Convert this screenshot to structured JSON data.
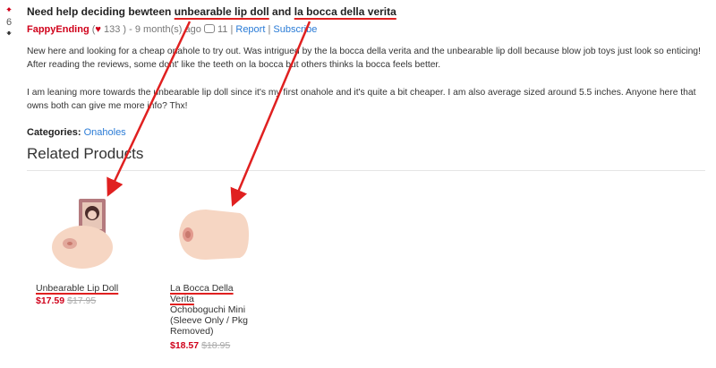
{
  "post": {
    "votes": "6",
    "title_prefix": "Need help deciding bewteen ",
    "title_product_a": "unbearable lip doll",
    "title_and": " and ",
    "title_product_b": "la bocca della verita",
    "author": "FappyEnding",
    "karma": "133",
    "age": ") - 9 month(s) ago",
    "comments": "11",
    "report": "Report",
    "subscribe": "Subscribe",
    "paragraph1": "New here and looking for a cheap onahole to try out. Was intrigued by the la bocca della verita and the unbearable lip doll because blow job toys just look so enticing! After reading the reviews, some dont' like the teeth on la bocca but others thinks la bocca feels better.",
    "paragraph2": "I am leaning more towards the unbearable lip doll since it's my first onahole and it's quite a bit cheaper. I am also average sized around 5.5 inches. Anyone here that owns both can give me more info? Thx!",
    "categories_label": "Categories:",
    "category": "Onaholes"
  },
  "related": {
    "heading": "Related Products",
    "products": [
      {
        "name": "Unbearable Lip Doll",
        "subname": "",
        "price": "$17.59",
        "old_price": "$17.95"
      },
      {
        "name": "La Bocca Della Verita",
        "subname": "Ochoboguchi Mini (Sleeve Only / Pkg Removed)",
        "price": "$18.57",
        "old_price": "$18.95"
      }
    ]
  },
  "colors": {
    "accent": "#d0021b",
    "link": "#2a7bd6",
    "annotation": "#e02020"
  },
  "icons": [
    "arrow-up-icon",
    "arrow-down-icon",
    "heart-icon",
    "comment-icon"
  ]
}
